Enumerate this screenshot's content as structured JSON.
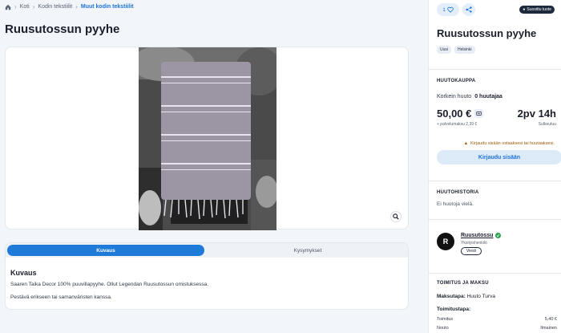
{
  "breadcrumb": {
    "items": [
      "Koti",
      "Kodin tekstiilit"
    ],
    "current": "Muut kodin tekstiilit"
  },
  "product": {
    "title": "Ruusutossun pyyhe"
  },
  "tabs": {
    "active": "Kuvaus",
    "inactive": "Kysymykset"
  },
  "description": {
    "heading": "Kuvaus",
    "lines": [
      "Saaren Taika Decor 100% puuvillapyyhe. Ollut Legendan Ruusutossun omistuksessa.",
      "Pestävä erikseen tai samanväristen kanssa."
    ]
  },
  "actions": {
    "favorite_count": "1",
    "verified_badge": "Suosittu tuote"
  },
  "chips": [
    "Uusi",
    "Helsinki"
  ],
  "auction": {
    "section_label": "HUUTOKAUPPA",
    "highest_bid_label": "Korkein huuto",
    "bidder_count": "0 huutajaa",
    "price": "50,00 €",
    "fee": "+ palvelumaksu 2,39 €",
    "time_left": "2pv 14h",
    "ends_label": "Sulkeutuu",
    "warning": "Kirjaudu sisään ostaaksesi tai huutaaksesi.",
    "login_button": "Kirjaudu sisään"
  },
  "history": {
    "section_label": "HUUTOHISTORIA",
    "empty_text": "Ei huutoja vielä."
  },
  "seller": {
    "avatar_letter": "R",
    "name": "Ruusutossu",
    "type": "Yksityishenkilö",
    "message_button": "Viesti"
  },
  "shipping": {
    "section_label": "TOIMITUS JA MAKSU",
    "payment_label": "Maksutapa:",
    "payment_value": "Huuto Turva",
    "delivery_label": "Toimitustapa:",
    "rows": [
      {
        "label": "Toimitus",
        "value": "5,40 €"
      },
      {
        "label": "Nouto",
        "value": "Ilmainen"
      }
    ]
  },
  "colors": {
    "accent": "#1e7bd9",
    "background": "#f2f5f9",
    "warning": "#9a5a07",
    "verified": "#2aa14e"
  }
}
